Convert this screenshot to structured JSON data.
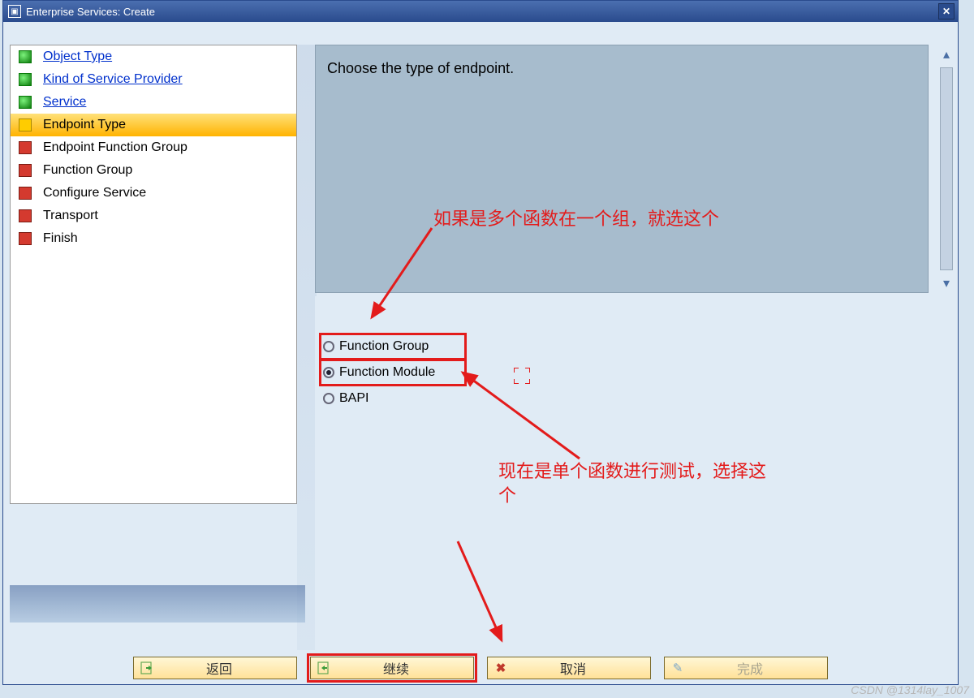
{
  "window": {
    "title": "Enterprise Services: Create"
  },
  "sidebar": {
    "items": [
      {
        "label": "Object Type",
        "status": "green",
        "link": true
      },
      {
        "label": "Kind of Service Provider",
        "status": "green",
        "link": true
      },
      {
        "label": "Service",
        "status": "green",
        "link": true
      },
      {
        "label": "Endpoint Type",
        "status": "yellow",
        "link": false,
        "selected": true
      },
      {
        "label": "Endpoint Function Group",
        "status": "red",
        "link": false
      },
      {
        "label": "Function Group",
        "status": "red",
        "link": false
      },
      {
        "label": "Configure Service",
        "status": "red",
        "link": false
      },
      {
        "label": "Transport",
        "status": "red",
        "link": false
      },
      {
        "label": "Finish",
        "status": "red",
        "link": false
      }
    ]
  },
  "info": {
    "text": "Choose the type of endpoint."
  },
  "radio": {
    "option1": "Function Group",
    "option2": "Function Module",
    "option3": "BAPI",
    "selected_index": 1
  },
  "annotations": {
    "top": "如果是多个函数在一个组，就选这个",
    "bottom_line1": "现在是单个函数进行测试，选择这",
    "bottom_line2": "个"
  },
  "buttons": {
    "back": "返回",
    "continue": "继续",
    "cancel": "取消",
    "finish": "完成"
  },
  "watermark": "CSDN @1314lay_1007"
}
